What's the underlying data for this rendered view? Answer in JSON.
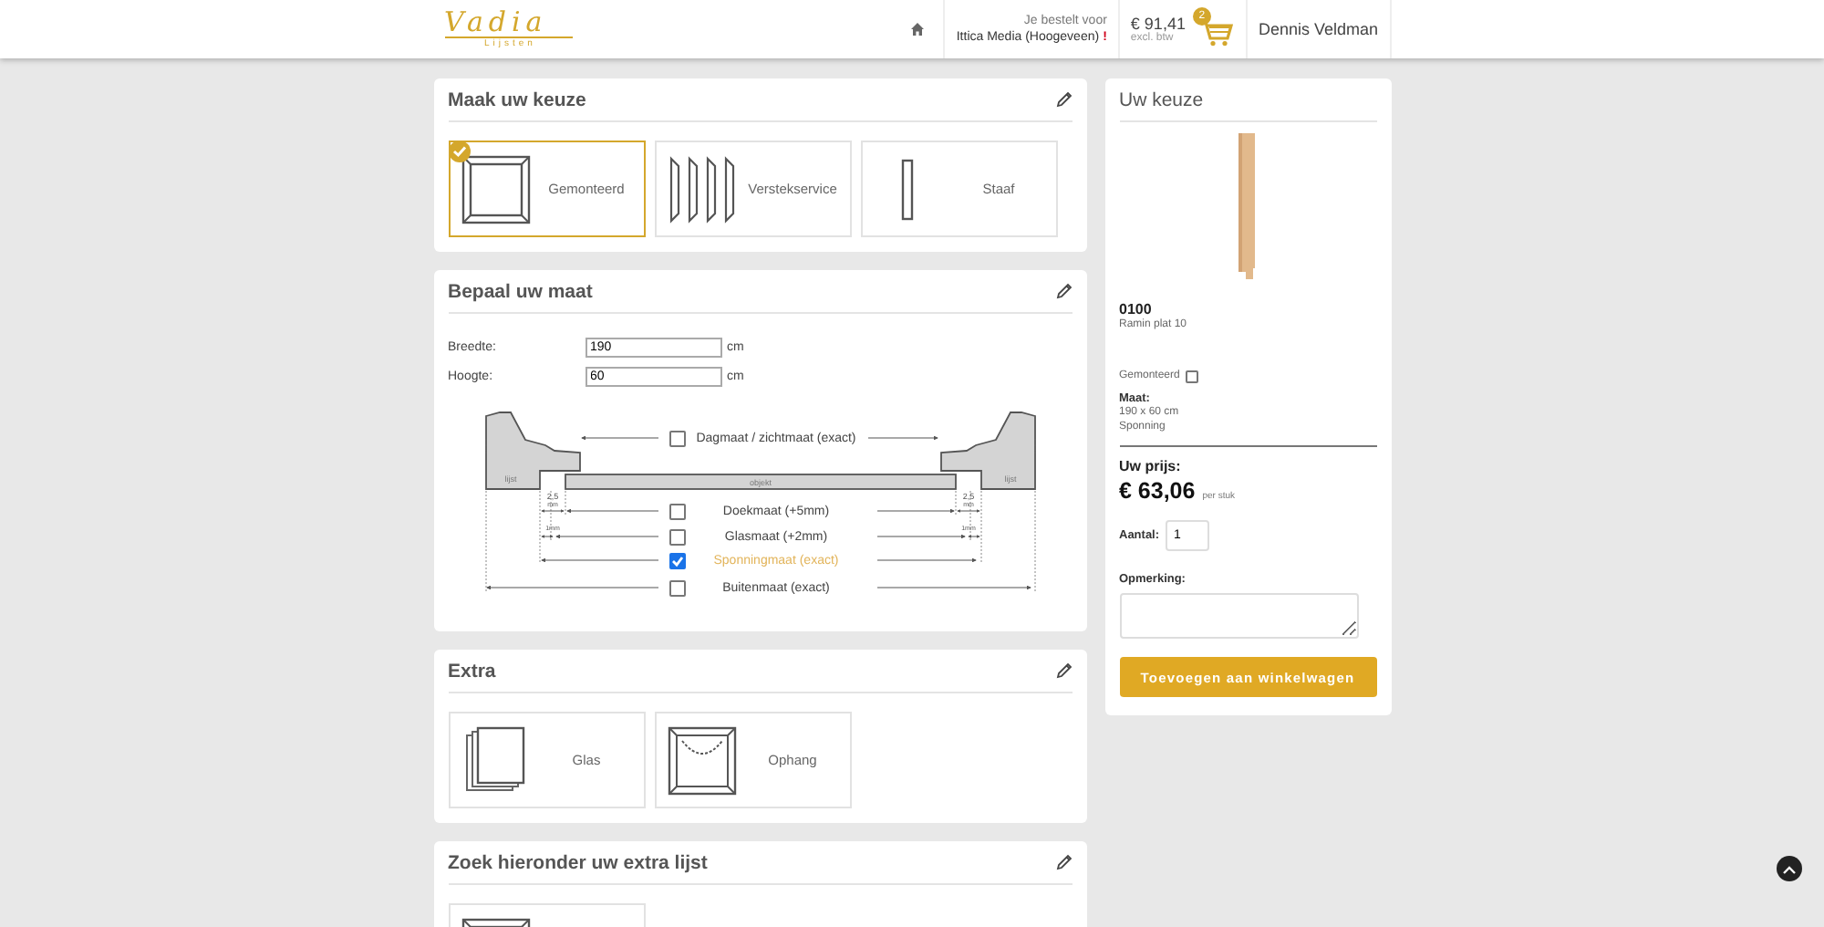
{
  "header": {
    "logo": {
      "name": "Vadia",
      "tagline": "Lijsten"
    },
    "order_for_label": "Je bestelt voor",
    "customer": "Ittica Media (Hoogeveen)",
    "warning": "!",
    "cart_total": "€ 91,41",
    "cart_note": "excl. btw",
    "cart_count": "2",
    "user": "Dennis Veldman"
  },
  "sections": [
    {
      "title": "Maak uw keuze",
      "kind": "options",
      "options": [
        {
          "label": "Gemonteerd",
          "kind": "frame",
          "selected": true
        },
        {
          "label": "Verstekservice",
          "kind": "pieces",
          "selected": false
        },
        {
          "label": "Staaf",
          "kind": "bar",
          "selected": false
        }
      ]
    },
    {
      "title": "Bepaal uw maat",
      "kind": "size",
      "fields": [
        {
          "label": "Breedte:",
          "value": "190",
          "unit": "cm"
        },
        {
          "label": "Hoogte:",
          "value": "60",
          "unit": "cm"
        }
      ],
      "measures": [
        {
          "label": "Dagmaat / zichtmaat (exact)",
          "checked": false
        },
        {
          "label": "Doekmaat (+5mm)",
          "checked": false
        },
        {
          "label": "Glasmaat (+2mm)",
          "checked": false
        },
        {
          "label": "Sponningmaat (exact)",
          "checked": true
        },
        {
          "label": "Buitenmaat (exact)",
          "checked": false
        }
      ],
      "sides": [
        {
          "frame": "lijst",
          "gap_value": "2,5",
          "gap_unit": "mm",
          "small_gap": "1mm"
        },
        {
          "frame": "lijst",
          "gap_value": "2,5",
          "gap_unit": "mm",
          "small_gap": "1mm"
        }
      ],
      "object": "objekt"
    },
    {
      "title": "Extra",
      "kind": "options",
      "options": [
        {
          "label": "Glas",
          "kind": "glass",
          "selected": false
        },
        {
          "label": "Ophang",
          "kind": "hanger",
          "selected": false
        }
      ]
    },
    {
      "title": "Zoek hieronder uw extra lijst",
      "kind": "options",
      "options": [
        {
          "kind": "frame",
          "selected": false
        }
      ]
    }
  ],
  "summary": {
    "title": "Uw keuze",
    "code": "0100",
    "name": "Ramin plat 10",
    "assembled_label": "Gemonteerd",
    "assembled": false,
    "size_label": "Maat:",
    "size": "190 x 60 cm",
    "size_type": "Sponning",
    "price_label": "Uw prijs:",
    "price": "€ 63,06",
    "price_unit": "per stuk",
    "quantity_label": "Aantal:",
    "quantity": "1",
    "remark_label": "Opmerking:",
    "button": "Toevoegen aan winkelwagen"
  }
}
